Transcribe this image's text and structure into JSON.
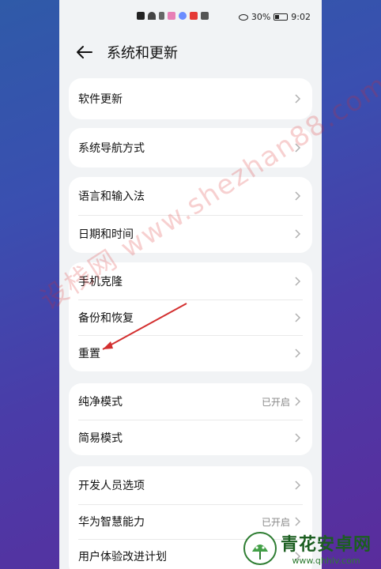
{
  "status_bar": {
    "battery_pct": "30%",
    "time": "9:02"
  },
  "header": {
    "title": "系统和更新"
  },
  "groups": [
    {
      "items": [
        {
          "label": "软件更新",
          "value": ""
        }
      ]
    },
    {
      "items": [
        {
          "label": "系统导航方式",
          "value": ""
        }
      ]
    },
    {
      "items": [
        {
          "label": "语言和输入法",
          "value": ""
        },
        {
          "label": "日期和时间",
          "value": ""
        }
      ]
    },
    {
      "items": [
        {
          "label": "手机克隆",
          "value": ""
        },
        {
          "label": "备份和恢复",
          "value": ""
        },
        {
          "label": "重置",
          "value": ""
        }
      ]
    },
    {
      "items": [
        {
          "label": "纯净模式",
          "value": "已开启"
        },
        {
          "label": "简易模式",
          "value": ""
        }
      ]
    },
    {
      "items": [
        {
          "label": "开发人员选项",
          "value": ""
        },
        {
          "label": "华为智慧能力",
          "value": "已开启"
        },
        {
          "label": "用户体验改进计划",
          "value": ""
        }
      ]
    }
  ],
  "watermark": {
    "text": "设栈网 www.shezhan88.com"
  },
  "brand": {
    "name": "青花安卓网",
    "url": "www.qhhlv.com"
  },
  "colors": {
    "accent_arrow": "#d32f2f",
    "card_bg": "#ffffff",
    "page_bg": "#f1f3f5"
  }
}
